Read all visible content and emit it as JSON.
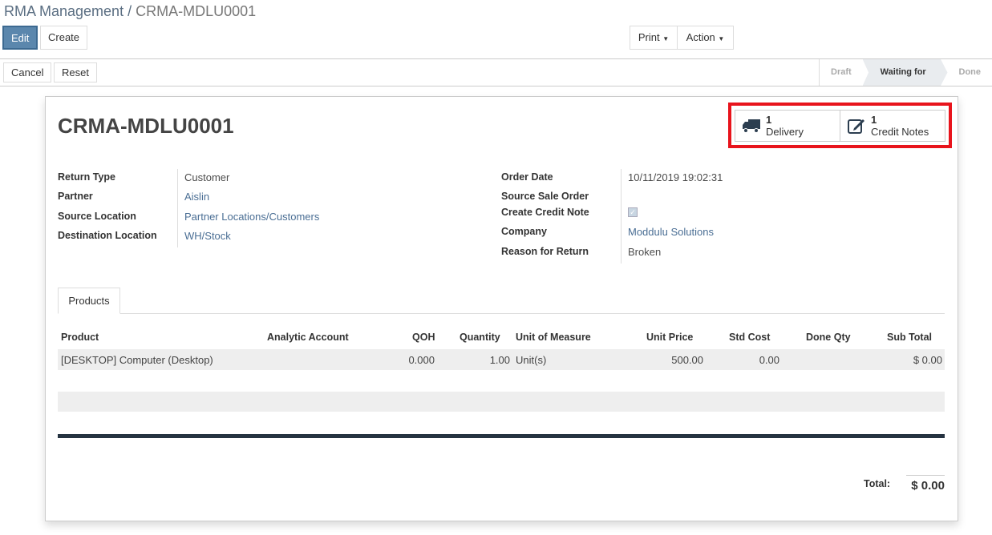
{
  "breadcrumb": {
    "parent": "RMA Management",
    "current": "CRMA-MDLU0001"
  },
  "toolbar": {
    "edit": "Edit",
    "create": "Create",
    "print": "Print",
    "action": "Action",
    "cancel": "Cancel",
    "reset": "Reset"
  },
  "statusbar": {
    "stages": [
      "Draft",
      "Waiting for Product",
      "Done"
    ],
    "active": "Waiting for Product"
  },
  "record": {
    "name": "CRMA-MDLU0001"
  },
  "smart_buttons": [
    {
      "count": "1",
      "label": "Delivery",
      "icon": "truck-icon"
    },
    {
      "count": "1",
      "label": "Credit Notes",
      "icon": "edit-icon"
    }
  ],
  "fields_left": [
    {
      "label": "Return Type",
      "value": "Customer"
    },
    {
      "label": "Partner",
      "value": "Aislin"
    },
    {
      "label": "Source Location",
      "value": "Partner Locations/Customers"
    },
    {
      "label": "Destination Location",
      "value": "WH/Stock"
    }
  ],
  "fields_right": [
    {
      "label": "Order Date",
      "value": "10/11/2019 19:02:31"
    },
    {
      "label": "Source Sale Order",
      "value": ""
    },
    {
      "label": "Create Credit Note",
      "value": true
    },
    {
      "label": "Company",
      "value": "Moddulu Solutions"
    },
    {
      "label": "Reason for Return",
      "value": "Broken"
    }
  ],
  "tabs": [
    "Products"
  ],
  "table": {
    "columns": [
      "Product",
      "Analytic Account",
      "QOH",
      "Quantity",
      "Unit of Measure",
      "Unit Price",
      "Std Cost",
      "Done Qty",
      "Sub Total"
    ],
    "rows": [
      [
        "[DESKTOP] Computer (Desktop)",
        "",
        "0.000",
        "1.00",
        "Unit(s)",
        "500.00",
        "0.00",
        "",
        "$ 0.00"
      ]
    ]
  },
  "total": {
    "label": "Total:",
    "value": "$ 0.00"
  },
  "colors": {
    "primary": "#5b87ad",
    "highlight": "#e8141c"
  }
}
